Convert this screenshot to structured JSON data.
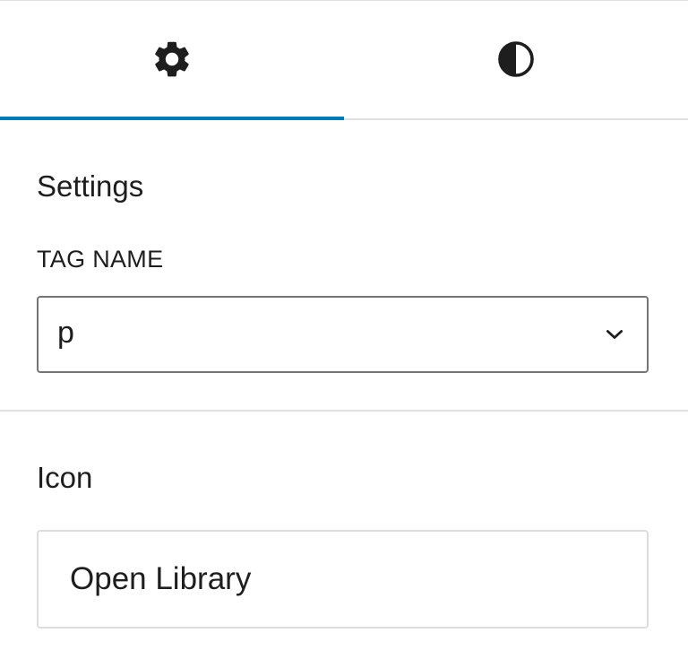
{
  "tabs": [
    {
      "label": "Settings",
      "icon": "gear-icon",
      "active": true
    },
    {
      "label": "Styles",
      "icon": "contrast-icon",
      "active": false
    }
  ],
  "settings_section": {
    "title": "Settings",
    "tag_name_label": "TAG NAME",
    "tag_name_value": "p"
  },
  "icon_section": {
    "title": "Icon",
    "open_library_label": "Open Library"
  },
  "colors": {
    "accent": "#007cba",
    "text": "#1e1e1e",
    "border": "#757575",
    "divider": "#e0e0e0"
  }
}
